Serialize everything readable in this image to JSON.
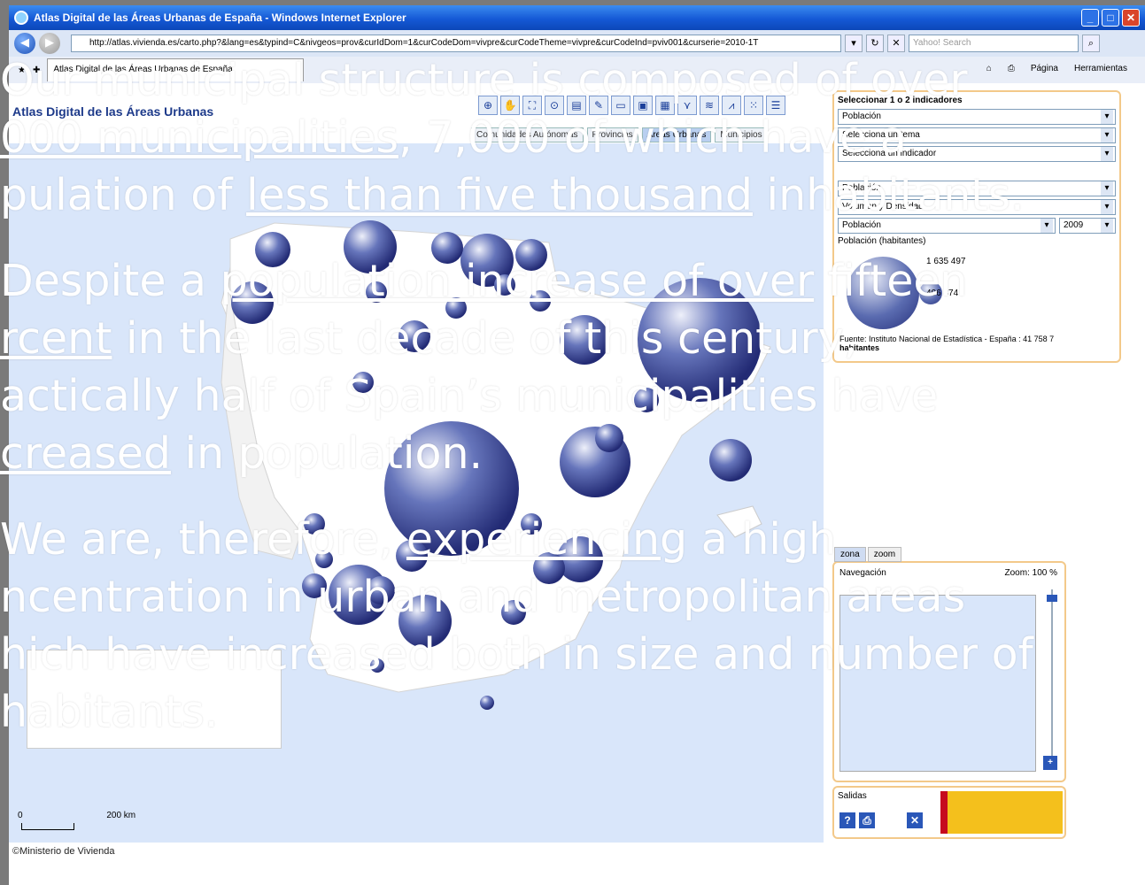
{
  "window": {
    "title": "Atlas Digital de las Áreas Urbanas de España - Windows Internet Explorer",
    "url": "http://atlas.vivienda.es/carto.php?&lang=es&typind=C&nivgeos=prov&curIdDom=1&curCodeDom=vivpre&curCodeTheme=vivpre&curCodeInd=pviv001&curserie=2010-1T",
    "search_placeholder": "Yahoo! Search",
    "tab_title": "Atlas Digital de las Áreas Urbanas de España",
    "tools": [
      "Página",
      "Herramientas"
    ]
  },
  "app": {
    "title": "Atlas Digital de las Áreas Urbanas",
    "levels": [
      "Comunidades Autónomas",
      "Provincias",
      "Áreas Urbanas",
      "Municipios"
    ],
    "active_level": "Áreas Urbanas",
    "credit": "©Ministerio de Vivienda",
    "scale": {
      "zero": "0",
      "max": "200 km"
    }
  },
  "panel": {
    "header": "Seleccionar 1 o 2 indicadores",
    "select1": "Población",
    "select2": "Selecciona un tema",
    "select3": "Selecciona un indicador",
    "select4": "Población",
    "select5": "Volumen y Densidad",
    "select6": "Población",
    "year": "2009",
    "legend_title": "Población (habitantes)",
    "legend_value1": "1 635 497",
    "legend_value2": "406 874",
    "source": "Fuente: Instituto Nacional de Estadística - España : 41 758 7",
    "source_unit": "habitantes"
  },
  "zoom": {
    "tabs": [
      "zona",
      "zoom"
    ],
    "label": "Navegación",
    "zoom_text": "Zoom: 100 %"
  },
  "outputs": {
    "label": "Salidas"
  },
  "overlay": {
    "line1": "Our municipal structure is composed of over",
    "line2a": "000 municipalities",
    "line2b": ", 7,000 of which have a",
    "line3a": "pulation of ",
    "line3b": "less than five thousand",
    "line3c": " inhabitants.",
    "line4a": "Despite a ",
    "line4b": "population increase of over",
    "line4c": " fifteen",
    "line5a": "rcent",
    "line5b": " in the last decade of this century,",
    "line6a": "actically half of Spain’s municipalities have",
    "line7a": "creased",
    "line7b": " in population.",
    "line8a": "We are, therefore, ",
    "line8b": "experiencing",
    "line8c": " a high",
    "line9a": "ncentration in urban",
    "line9b": " and metropolitan areas",
    "line10": "hich have increased both in size and number of",
    "line11": "habitants."
  }
}
